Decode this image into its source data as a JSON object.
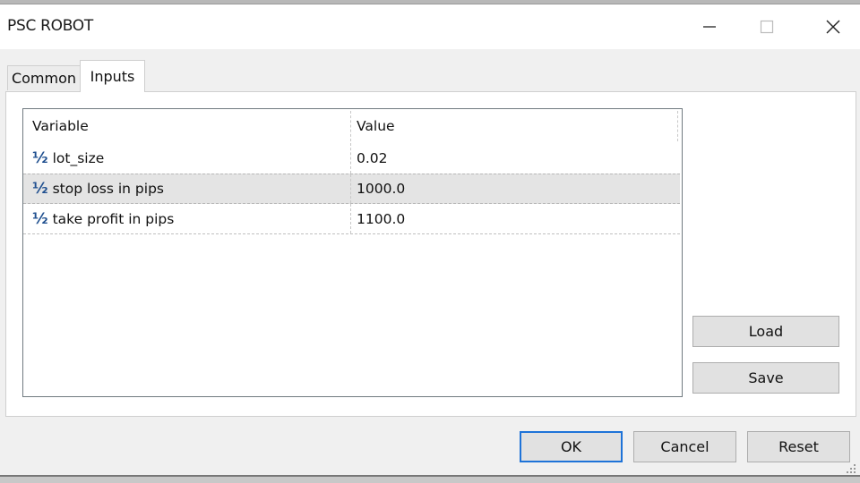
{
  "window": {
    "title": "PSC ROBOT",
    "controls": {
      "minimize_icon": "minimize-icon",
      "maximize_icon": "maximize-icon",
      "close_icon": "close-icon"
    }
  },
  "tabs": [
    {
      "label": "Common",
      "active": false
    },
    {
      "label": "Inputs",
      "active": true
    }
  ],
  "grid": {
    "columns": [
      "Variable",
      "Value"
    ],
    "rows": [
      {
        "icon": "½",
        "variable": "lot_size",
        "value": "0.02",
        "selected": false
      },
      {
        "icon": "½",
        "variable": "stop loss in pips",
        "value": "1000.0",
        "selected": true
      },
      {
        "icon": "½",
        "variable": "take profit in pips",
        "value": "1100.0",
        "selected": false
      }
    ]
  },
  "side_buttons": {
    "load": "Load",
    "save": "Save"
  },
  "dialog_buttons": {
    "ok": "OK",
    "cancel": "Cancel",
    "reset": "Reset"
  },
  "colors": {
    "focus_border": "#1e73d8",
    "selected_row": "#e4e4e4",
    "type_icon": "#1f4f8f"
  }
}
